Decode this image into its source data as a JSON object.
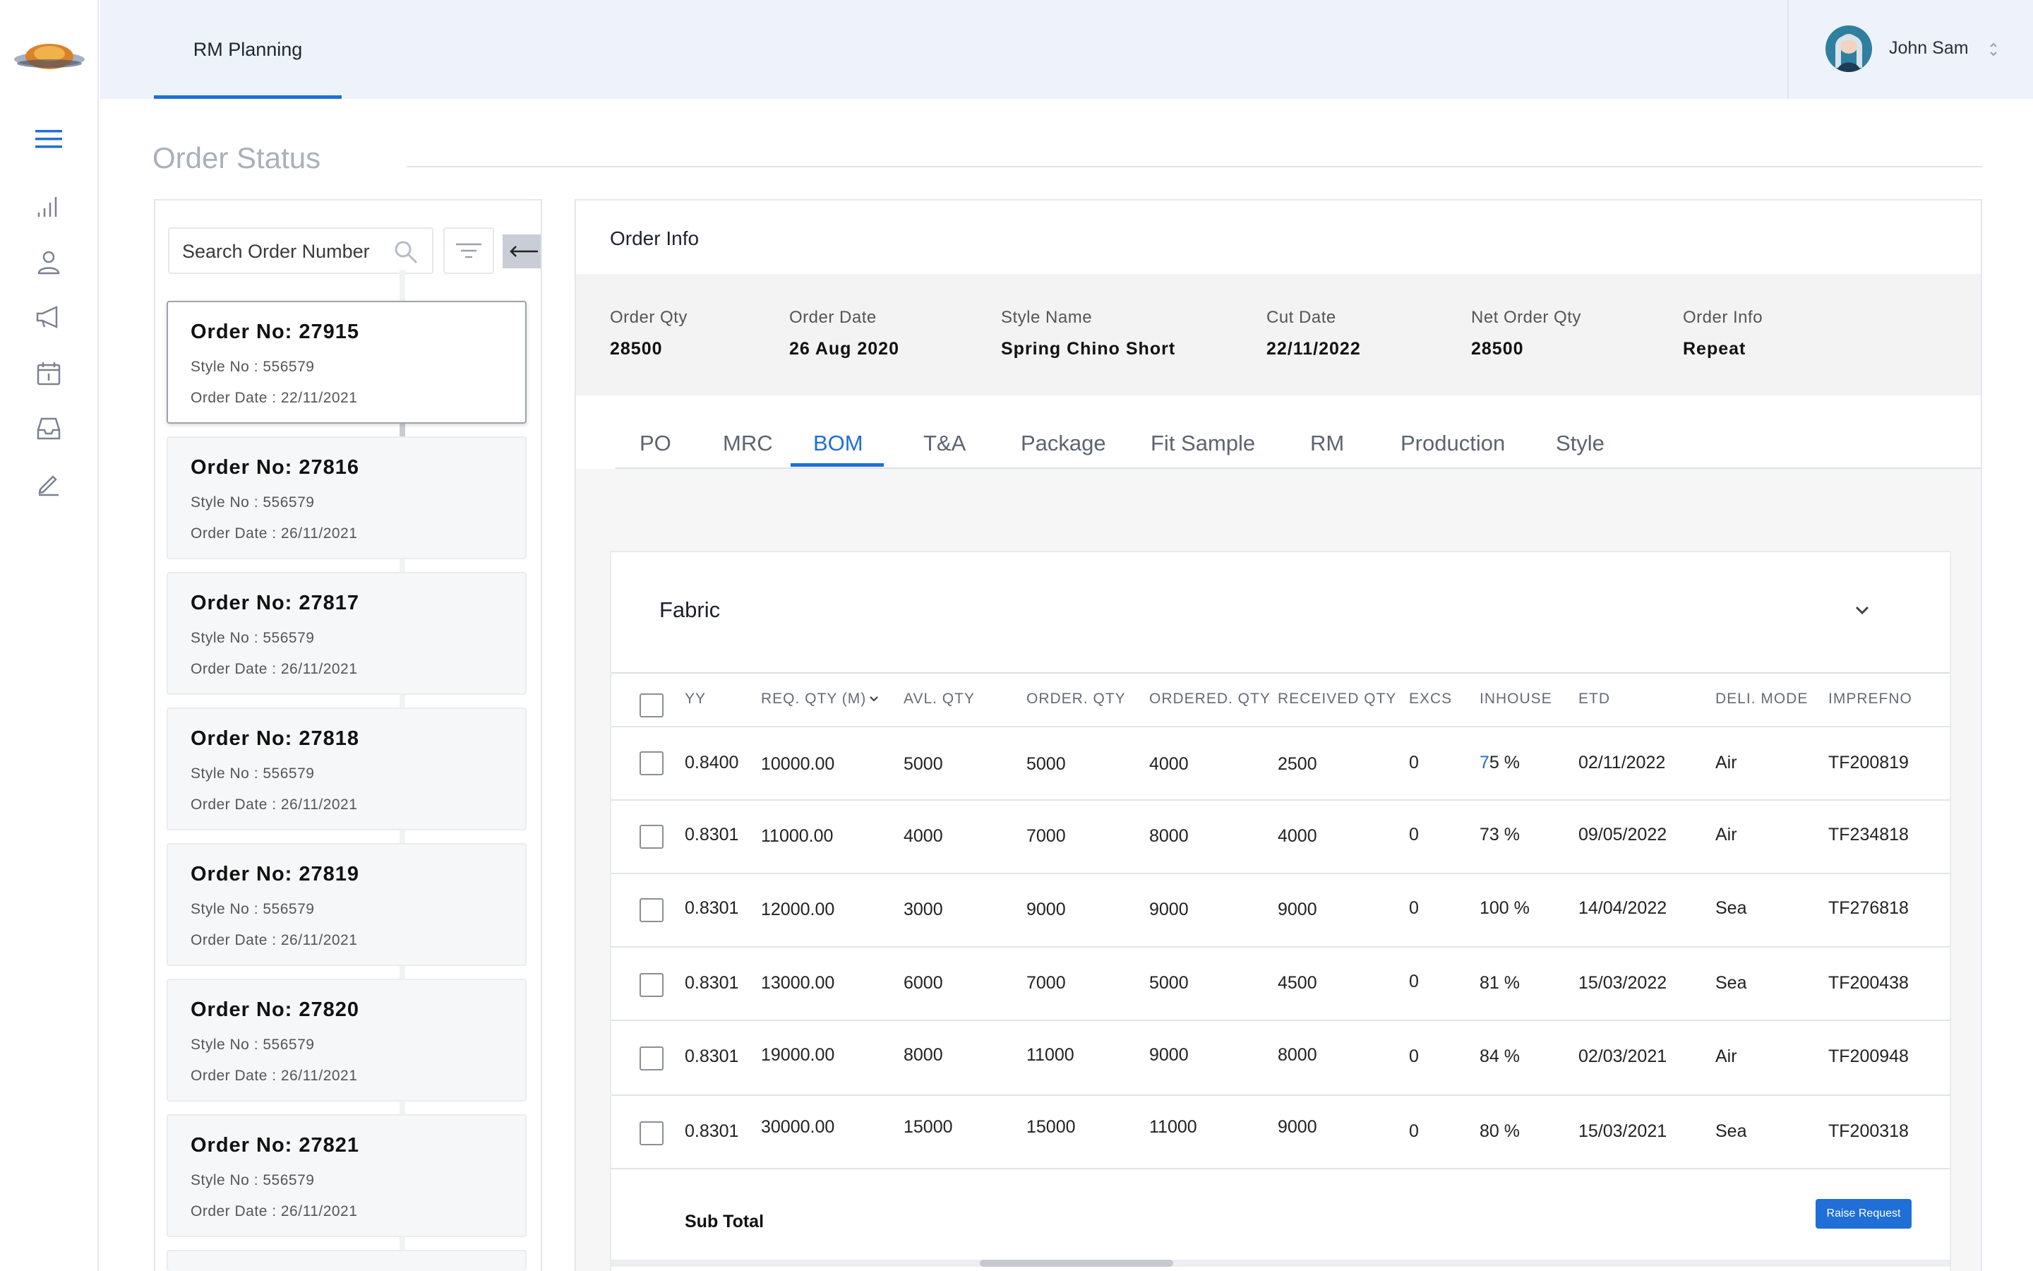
{
  "header": {
    "nav_tab": "RM Planning",
    "user_name": "John Sam"
  },
  "page": {
    "title": "Order Status"
  },
  "search": {
    "placeholder": "Search Order Number"
  },
  "orders": [
    {
      "title": "Order No: 27915",
      "style": "Style No : 556579",
      "date": "Order Date : 22/11/2021"
    },
    {
      "title": "Order No: 27816",
      "style": "Style No : 556579",
      "date": "Order Date : 26/11/2021"
    },
    {
      "title": "Order No: 27817",
      "style": "Style No : 556579",
      "date": "Order Date : 26/11/2021"
    },
    {
      "title": "Order No: 27818",
      "style": "Style No : 556579",
      "date": "Order Date : 26/11/2021"
    },
    {
      "title": "Order No: 27819",
      "style": "Style No : 556579",
      "date": "Order Date : 26/11/2021"
    },
    {
      "title": "Order No: 27820",
      "style": "Style No : 556579",
      "date": "Order Date : 26/11/2021"
    },
    {
      "title": "Order No: 27821",
      "style": "Style No : 556579",
      "date": "Order Date : 26/11/2021"
    }
  ],
  "order_info": {
    "heading": "Order Info",
    "fields": [
      {
        "label": "Order Qty",
        "value": "28500"
      },
      {
        "label": "Order Date",
        "value": "26 Aug 2020"
      },
      {
        "label": "Style Name",
        "value": "Spring Chino Short"
      },
      {
        "label": "Cut Date",
        "value": "22/11/2022"
      },
      {
        "label": "Net Order Qty",
        "value": "28500"
      },
      {
        "label": "Order Info",
        "value": "Repeat"
      }
    ]
  },
  "tabs": [
    "PO",
    "MRC",
    "BOM",
    "T&A",
    "Package",
    "Fit Sample",
    "RM",
    "Production",
    "Style"
  ],
  "active_tab": "BOM",
  "fabric": {
    "title": "Fabric",
    "columns": [
      "YY",
      "REQ. QTY (M)",
      "AVL. QTY",
      "ORDER. QTY",
      "ORDERED. QTY",
      "RECEIVED QTY",
      "EXCS",
      "INHOUSE",
      "ETD",
      "DELI. MODE",
      "IMPREFNO"
    ],
    "rows": [
      [
        "0.8400",
        "10000.00",
        "5000",
        "5000",
        "4000",
        "2500",
        "0",
        "75 %",
        "02/11/2022",
        "Air",
        "TF200819"
      ],
      [
        "0.8301",
        "11000.00",
        "4000",
        "7000",
        "8000",
        "4000",
        "0",
        "73 %",
        "09/05/2022",
        "Air",
        "TF234818"
      ],
      [
        "0.8301",
        "12000.00",
        "3000",
        "9000",
        "9000",
        "9000",
        "0",
        "100 %",
        "14/04/2022",
        "Sea",
        "TF276818"
      ],
      [
        "0.8301",
        "13000.00",
        "6000",
        "7000",
        "5000",
        "4500",
        "0",
        "81 %",
        "15/03/2022",
        "Sea",
        "TF200438"
      ],
      [
        "0.8301",
        "19000.00",
        "8000",
        "11000",
        "9000",
        "8000",
        "0",
        "84 %",
        "02/03/2021",
        "Air",
        "TF200948"
      ],
      [
        "0.8301",
        "30000.00",
        "15000",
        "15000",
        "11000",
        "9000",
        "0",
        "80 %",
        "15/03/2021",
        "Sea",
        "TF200318"
      ]
    ],
    "subtotal_label": "Sub Total",
    "raise_button": "Raise Request"
  },
  "colors": {
    "accent": "#1f6fd6",
    "header_bg": "#eef3fb"
  },
  "icons": {
    "rail": [
      "menu-icon",
      "bar-chart-icon",
      "user-icon",
      "megaphone-icon",
      "calendar-icon",
      "inbox-icon",
      "edit-icon"
    ]
  }
}
